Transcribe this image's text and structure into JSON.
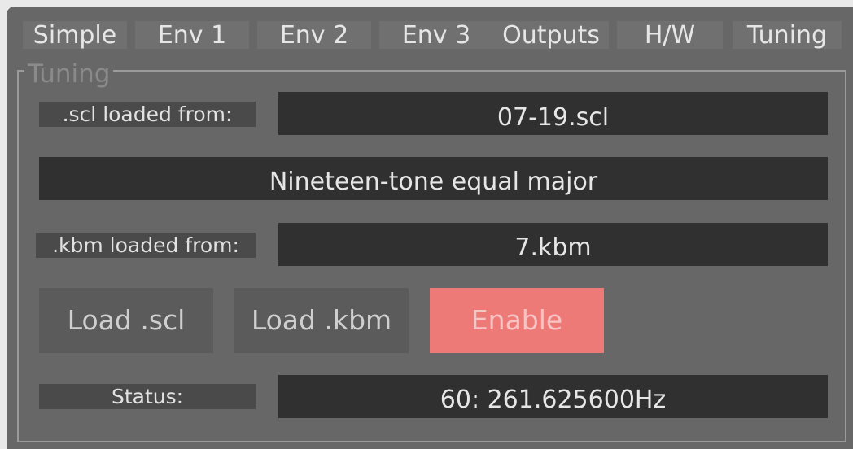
{
  "tabs": [
    "Simple",
    "Env 1",
    "Env 2",
    "Env 3",
    "Outputs",
    "H/W",
    "Tuning"
  ],
  "group": {
    "title": "Tuning"
  },
  "scl": {
    "label": ".scl loaded from:",
    "value": "07-19.scl"
  },
  "scale_description": "Nineteen-tone equal major",
  "kbm": {
    "label": ".kbm loaded from:",
    "value": "7.kbm"
  },
  "buttons": {
    "load_scl": "Load .scl",
    "load_kbm": "Load .kbm",
    "enable": "Enable"
  },
  "status": {
    "label": "Status:",
    "value": "60: 261.625600Hz"
  },
  "colors": {
    "background": "#676767",
    "tab": "#707070",
    "label_bg": "#4a4a4a",
    "field_bg": "#303030",
    "button_bg": "#5b5b5b",
    "enable_bg": "#ee7a78"
  }
}
